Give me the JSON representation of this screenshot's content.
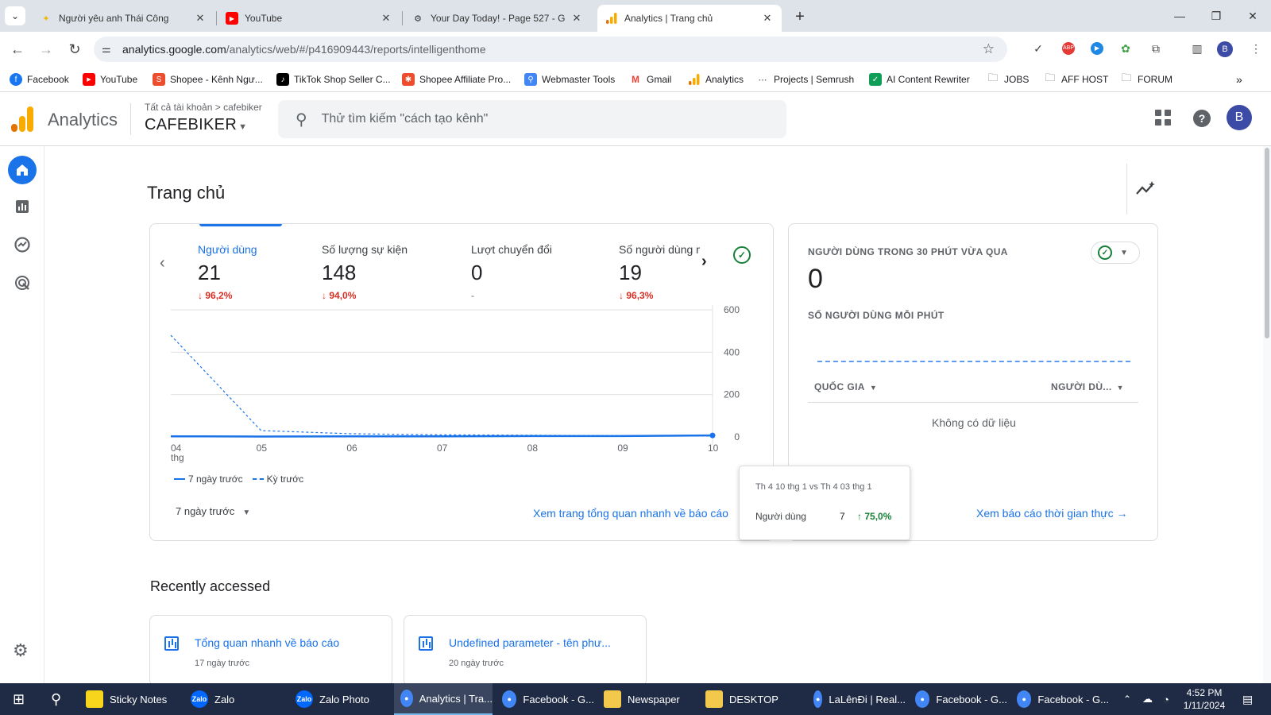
{
  "browser": {
    "tabs": [
      {
        "title": "Người yêu anh Thái Công",
        "active": false
      },
      {
        "title": "YouTube",
        "active": false
      },
      {
        "title": "Your Day Today! - Page 527 - G",
        "active": false
      },
      {
        "title": "Analytics | Trang chủ",
        "active": true
      }
    ],
    "url_host": "analytics.google.com",
    "url_path": "/analytics/web/#/p416909443/reports/intelligenthome",
    "profile_initial": "B",
    "bookmarks": [
      {
        "label": "Facebook",
        "icon": "facebook-icon",
        "color": "#1877f2"
      },
      {
        "label": "YouTube",
        "icon": "youtube-icon",
        "color": "#ff0000"
      },
      {
        "label": "Shopee - Kênh Ngư...",
        "icon": "shopee-icon",
        "color": "#ee4d2d"
      },
      {
        "label": "TikTok Shop Seller C...",
        "icon": "tiktok-icon",
        "color": "#000000"
      },
      {
        "label": "Shopee Affiliate Pro...",
        "icon": "shopee-affiliate-icon",
        "color": "#ee4d2d"
      },
      {
        "label": "Webmaster Tools",
        "icon": "webmaster-icon",
        "color": "#4285f4"
      },
      {
        "label": "Gmail",
        "icon": "gmail-icon",
        "color": "#ea4335"
      },
      {
        "label": "Analytics",
        "icon": "analytics-icon",
        "color": "#f9ab00"
      },
      {
        "label": "Projects | Semrush",
        "icon": "semrush-icon",
        "color": "#555555"
      },
      {
        "label": "AI Content Rewriter",
        "icon": "checkbox-icon",
        "color": "#0f9d58"
      },
      {
        "label": "JOBS",
        "icon": "folder-icon",
        "color": "#5f6368"
      },
      {
        "label": "AFF HOST",
        "icon": "folder-icon",
        "color": "#5f6368"
      },
      {
        "label": "FORUM",
        "icon": "folder-icon",
        "color": "#5f6368"
      }
    ]
  },
  "ga": {
    "app_name": "Analytics",
    "breadcrumb_root": "Tất cả tài khoản",
    "breadcrumb_sep": ">",
    "breadcrumb_account": "cafebiker",
    "property": "CAFEBIKER",
    "search_placeholder": "Thử tìm kiếm \"cách tạo kênh\"",
    "avatar_initial": "B"
  },
  "page": {
    "title": "Trang chủ",
    "metrics": [
      {
        "label": "Người dùng",
        "value": "21",
        "delta": "96,2%",
        "direction": "down"
      },
      {
        "label": "Số lượng sự kiện",
        "value": "148",
        "delta": "94,0%",
        "direction": "down"
      },
      {
        "label": "Lượt chuyển đổi",
        "value": "0",
        "delta": "-",
        "direction": "none"
      },
      {
        "label": "Số người dùng mới",
        "value": "19",
        "delta": "96,3%",
        "direction": "down"
      }
    ],
    "legend_current": "7 ngày trước",
    "legend_previous": "Kỳ trước",
    "range_label": "7 ngày trước",
    "overview_link": "Xem trang tổng quan nhanh về báo cáo"
  },
  "chart_data": {
    "type": "line",
    "categories": [
      "04 thg",
      "05",
      "06",
      "07",
      "08",
      "09",
      "10"
    ],
    "yticks": [
      0,
      200,
      400,
      600
    ],
    "ylim": [
      0,
      600
    ],
    "series": [
      {
        "name": "7 ngày trước",
        "style": "solid",
        "values": [
          3,
          2,
          3,
          3,
          4,
          4,
          7
        ]
      },
      {
        "name": "Kỳ trước",
        "style": "dashed",
        "values": [
          480,
          30,
          15,
          10,
          8,
          6,
          4
        ]
      }
    ],
    "color": "#1a73e8"
  },
  "tooltip": {
    "title": "Th 4 10 thg 1 vs Th 4 03 thg 1",
    "label": "Người dùng",
    "value": "7",
    "delta": "75,0%"
  },
  "realtime": {
    "title": "NGƯỜI DÙNG TRONG 30 PHÚT VỪA QUA",
    "value": "0",
    "subtitle": "SỐ NGƯỜI DÙNG MỖI PHÚT",
    "col_country": "QUỐC GIA",
    "col_users": "NGƯỜI DÙ...",
    "empty": "Không có dữ liệu",
    "link": "Xem báo cáo thời gian thực"
  },
  "recent": {
    "title": "Recently accessed",
    "items": [
      {
        "title": "Tổng quan nhanh về báo cáo",
        "time": "17 ngày trước"
      },
      {
        "title": "Undefined parameter - tên phư...",
        "time": "20 ngày trước"
      }
    ]
  },
  "taskbar": {
    "items": [
      {
        "label": "Sticky Notes",
        "color": "#f7d51d"
      },
      {
        "label": "Zalo",
        "color": "#0068ff"
      },
      {
        "label": "Zalo Photo",
        "color": "#0068ff"
      },
      {
        "label": "Analytics | Tra...",
        "color": "#4285f4"
      },
      {
        "label": "Facebook - G...",
        "color": "#4285f4"
      },
      {
        "label": "Newspaper",
        "color": "#f2c94c"
      },
      {
        "label": "DESKTOP",
        "color": "#f2c94c"
      },
      {
        "label": "LaLênĐi | Real...",
        "color": "#4285f4"
      },
      {
        "label": "Facebook - G...",
        "color": "#4285f4"
      },
      {
        "label": "Facebook - G...",
        "color": "#4285f4"
      }
    ],
    "time": "4:52 PM",
    "date": "1/11/2024"
  }
}
